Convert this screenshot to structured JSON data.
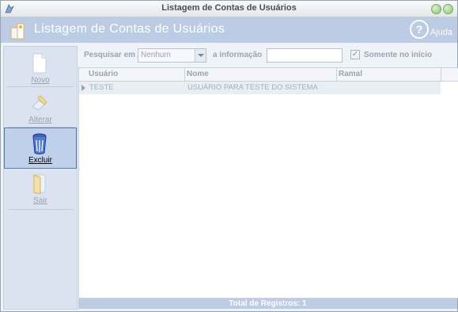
{
  "window": {
    "title": "Listagem de Contas de Usuários"
  },
  "header": {
    "title": "Listagem de Contas de Usuários",
    "help_label": "Ajuda",
    "help_glyph": "?"
  },
  "sidebar": {
    "items": [
      {
        "label": "Novo",
        "icon": "document-icon"
      },
      {
        "label": "Alterar",
        "icon": "edit-icon"
      },
      {
        "label": "Excluir",
        "icon": "trash-icon"
      },
      {
        "label": "Sair",
        "icon": "exit-door-icon"
      }
    ]
  },
  "filter": {
    "search_in_label": "Pesquisar em",
    "search_in_value": "Nenhum",
    "info_label": "a informação",
    "info_value": "",
    "only_start_label": "Somente no início",
    "only_start_checked": true
  },
  "grid": {
    "columns": [
      "Usuário",
      "Nome",
      "Ramal"
    ],
    "rows": [
      {
        "usuario": "TESTE",
        "nome": "USUÁRIO PARA TESTE DO SISTEMA",
        "ramal": ""
      }
    ]
  },
  "footer": {
    "total_label": "Total de Registros: 1"
  },
  "colors": {
    "header_bg": "#bccce4",
    "sidebar_bg": "#dae3ef",
    "active_btn": "#bed0ea"
  }
}
